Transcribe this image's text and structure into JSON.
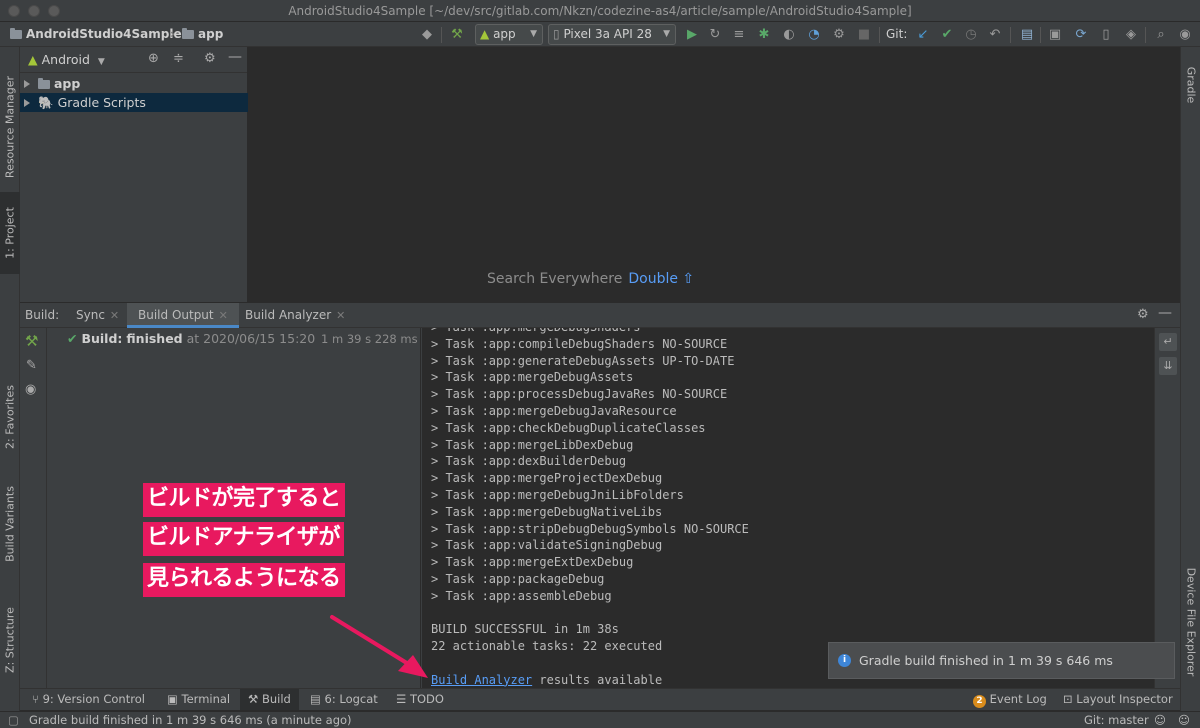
{
  "window": {
    "title": "AndroidStudio4Sample [~/dev/src/gitlab.com/Nkzn/codezine-as4/article/sample/AndroidStudio4Sample]"
  },
  "navbar": {
    "project": "AndroidStudio4Sample",
    "module": "app"
  },
  "toolbar": {
    "run_config": "app",
    "device": "Pixel 3a API 28",
    "git_label": "Git:"
  },
  "left_tabs": {
    "resource_manager": "Resource Manager",
    "project": "1: Project",
    "favorites": "2: Favorites",
    "build_variants": "Build Variants",
    "structure": "Z: Structure"
  },
  "right_tabs": {
    "gradle": "Gradle",
    "device_file_explorer": "Device File Explorer"
  },
  "project_pane": {
    "view_mode": "Android",
    "items": [
      {
        "label": "app"
      },
      {
        "label": "Gradle Scripts"
      }
    ]
  },
  "editor": {
    "search_hint": "Search Everywhere",
    "shortcut": "Double ⇧"
  },
  "build": {
    "label": "Build:",
    "tabs": [
      {
        "label": "Sync"
      },
      {
        "label": "Build Output"
      },
      {
        "label": "Build Analyzer"
      }
    ],
    "status_prefix": "Build:",
    "status": "finished",
    "timestamp": "at 2020/06/15 15:20",
    "duration": "1 m 39 s 228 ms",
    "console_lines": [
      "> Task :app:mergeDebugShaders",
      "> Task :app:compileDebugShaders NO-SOURCE",
      "> Task :app:generateDebugAssets UP-TO-DATE",
      "> Task :app:mergeDebugAssets",
      "> Task :app:processDebugJavaRes NO-SOURCE",
      "> Task :app:mergeDebugJavaResource",
      "> Task :app:checkDebugDuplicateClasses",
      "> Task :app:mergeLibDexDebug",
      "> Task :app:dexBuilderDebug",
      "> Task :app:mergeProjectDexDebug",
      "> Task :app:mergeDebugJniLibFolders",
      "> Task :app:mergeDebugNativeLibs",
      "> Task :app:stripDebugDebugSymbols NO-SOURCE",
      "> Task :app:validateSigningDebug",
      "> Task :app:mergeExtDexDebug",
      "> Task :app:packageDebug",
      "> Task :app:assembleDebug",
      "",
      "BUILD SUCCESSFUL in 1m 38s",
      "22 actionable tasks: 22 executed",
      ""
    ],
    "analyzer_link": "Build Analyzer",
    "analyzer_suffix": " results available"
  },
  "notification": {
    "text": "Gradle build finished in 1 m 39 s 646 ms"
  },
  "annotation": {
    "lines": [
      "ビルドが完了すると",
      "ビルドアナライザが",
      "見られるようになる"
    ],
    "color": "#e8195f"
  },
  "bottom_tabs": {
    "version_control": "9: Version Control",
    "terminal": "Terminal",
    "build": "Build",
    "logcat": "6: Logcat",
    "todo": "TODO",
    "event_log_count": "2",
    "event_log": "Event Log",
    "layout_inspector": "Layout Inspector"
  },
  "statusbar": {
    "message": "Gradle build finished in 1 m 39 s 646 ms (a minute ago)",
    "git": "Git: master"
  }
}
